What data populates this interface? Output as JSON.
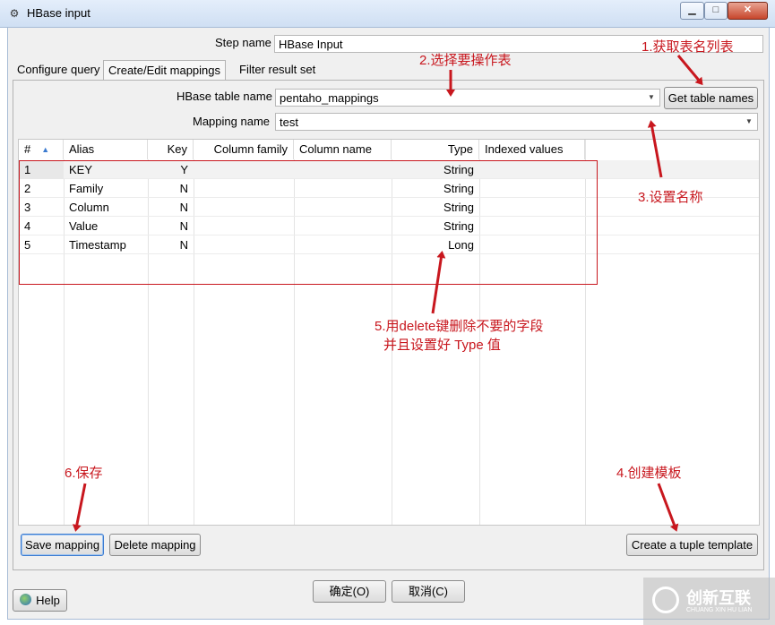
{
  "window": {
    "title": "HBase input",
    "icon": "kettle-step-icon"
  },
  "step_name": {
    "label": "Step name",
    "value": "HBase Input"
  },
  "tabs": [
    {
      "label": "Configure query"
    },
    {
      "label": "Create/Edit mappings"
    },
    {
      "label": "Filter result set"
    }
  ],
  "table_name": {
    "label": "HBase table name",
    "value": "pentaho_mappings",
    "button": "Get table names"
  },
  "mapping_name": {
    "label": "Mapping name",
    "value": "test"
  },
  "grid": {
    "columns": [
      "#",
      "Alias",
      "Key",
      "Column family",
      "Column name",
      "Type",
      "Indexed values"
    ],
    "rows": [
      {
        "n": "1",
        "alias": "KEY",
        "key": "Y",
        "family": "",
        "column": "",
        "type": "String",
        "indexed": ""
      },
      {
        "n": "2",
        "alias": "Family",
        "key": "N",
        "family": "",
        "column": "",
        "type": "String",
        "indexed": ""
      },
      {
        "n": "3",
        "alias": "Column",
        "key": "N",
        "family": "",
        "column": "",
        "type": "String",
        "indexed": ""
      },
      {
        "n": "4",
        "alias": "Value",
        "key": "N",
        "family": "",
        "column": "",
        "type": "String",
        "indexed": ""
      },
      {
        "n": "5",
        "alias": "Timestamp",
        "key": "N",
        "family": "",
        "column": "",
        "type": "Long",
        "indexed": ""
      }
    ]
  },
  "buttons": {
    "save": "Save mapping",
    "delete": "Delete mapping",
    "template": "Create a tuple template",
    "ok": "确定(O)",
    "cancel": "取消(C)",
    "help": "Help"
  },
  "annotations": {
    "a1": "1.获取表名列表",
    "a2": "2.选择要操作表",
    "a3": "3.设置名称",
    "a4": "4.创建模板",
    "a5_line1": "5.用delete键删除不要的字段",
    "a5_line2": "并且设置好 Type 值",
    "a6": "6.保存"
  },
  "watermark": {
    "brand": "创新互联",
    "sub": "CHUANG XIN HU LIAN"
  },
  "colors": {
    "annotation": "#c8171e",
    "accent": "#3b7bd0"
  }
}
